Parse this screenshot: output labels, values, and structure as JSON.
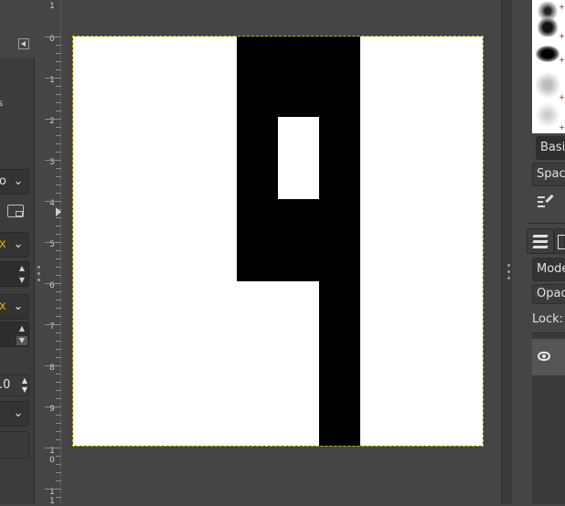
{
  "left_dock": {
    "mode_value": "o",
    "unit_1": "x",
    "unit_2": "x",
    "number_value": ".0"
  },
  "ruler": {
    "labels": [
      "1",
      "0",
      "1",
      "2",
      "3",
      "4",
      "5",
      "6",
      "7",
      "8",
      "9",
      "1\n0",
      "1\n1"
    ]
  },
  "right_dock": {
    "preset_label": "Basic",
    "spacing_label": "Spacin",
    "mode_label": "Mode",
    "opacity_label": "Opaci",
    "lock_label": "Lock:"
  },
  "colors": {
    "background": "#454545",
    "canvas": "#ffffff",
    "ink": "#000000",
    "boundary": "#c8b400"
  },
  "icons": {
    "collapse": "triangle-left-icon",
    "eye": "eye-icon",
    "layers": "layers-icon",
    "edit": "edit-icon"
  }
}
